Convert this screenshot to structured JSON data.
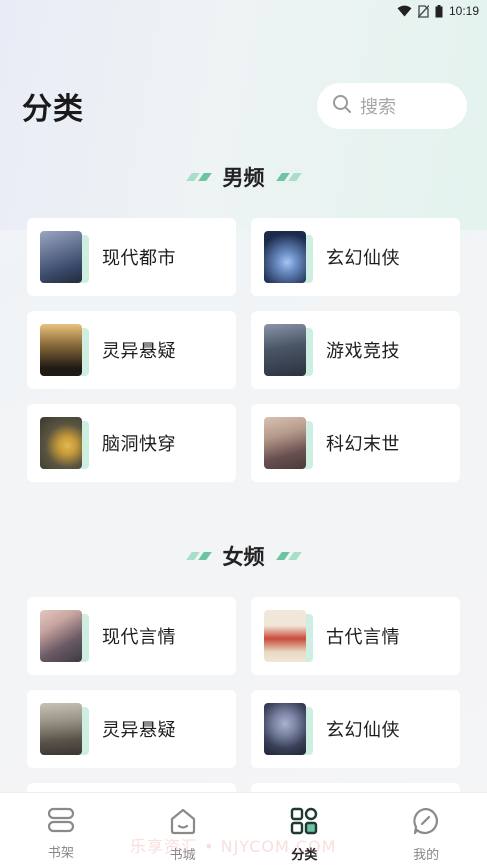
{
  "status_bar": {
    "time": "10:19"
  },
  "header": {
    "title": "分类",
    "search_placeholder": "搜索"
  },
  "sections": [
    {
      "title": "男频",
      "items": [
        {
          "label": "现代都市",
          "cover_colors": [
            "#3a4a6a",
            "#9aa6c2"
          ]
        },
        {
          "label": "玄幻仙侠",
          "cover_colors": [
            "#1b2b4a",
            "#6b8dc6"
          ]
        },
        {
          "label": "灵异悬疑",
          "cover_colors": [
            "#1f1a14",
            "#d3a15a"
          ]
        },
        {
          "label": "游戏竞技",
          "cover_colors": [
            "#2a3340",
            "#8a96a8"
          ]
        },
        {
          "label": "脑洞快穿",
          "cover_colors": [
            "#3a3a30",
            "#c79b3a"
          ]
        },
        {
          "label": "科幻末世",
          "cover_colors": [
            "#4a3a3a",
            "#b59a8a"
          ]
        }
      ]
    },
    {
      "title": "女频",
      "items": [
        {
          "label": "现代言情",
          "cover_colors": [
            "#3c3a44",
            "#c7a4a0"
          ]
        },
        {
          "label": "古代言情",
          "cover_colors": [
            "#f1e7d8",
            "#c84a3a"
          ]
        },
        {
          "label": "灵异悬疑",
          "cover_colors": [
            "#3a3530",
            "#9a9488"
          ]
        },
        {
          "label": "玄幻仙侠",
          "cover_colors": [
            "#1f2433",
            "#7a84a4"
          ]
        }
      ]
    }
  ],
  "tabs": [
    {
      "label": "书架",
      "icon": "bookshelf-icon",
      "active": false
    },
    {
      "label": "书城",
      "icon": "bookstore-icon",
      "active": false
    },
    {
      "label": "分类",
      "icon": "category-icon",
      "active": true
    },
    {
      "label": "我的",
      "icon": "profile-icon",
      "active": false
    }
  ],
  "watermark": "乐享资汇 • NJYCOM.COM",
  "colors": {
    "accent": "#6cc4a2",
    "accent_light": "#a7dfc9",
    "card_bg": "#ffffff"
  }
}
